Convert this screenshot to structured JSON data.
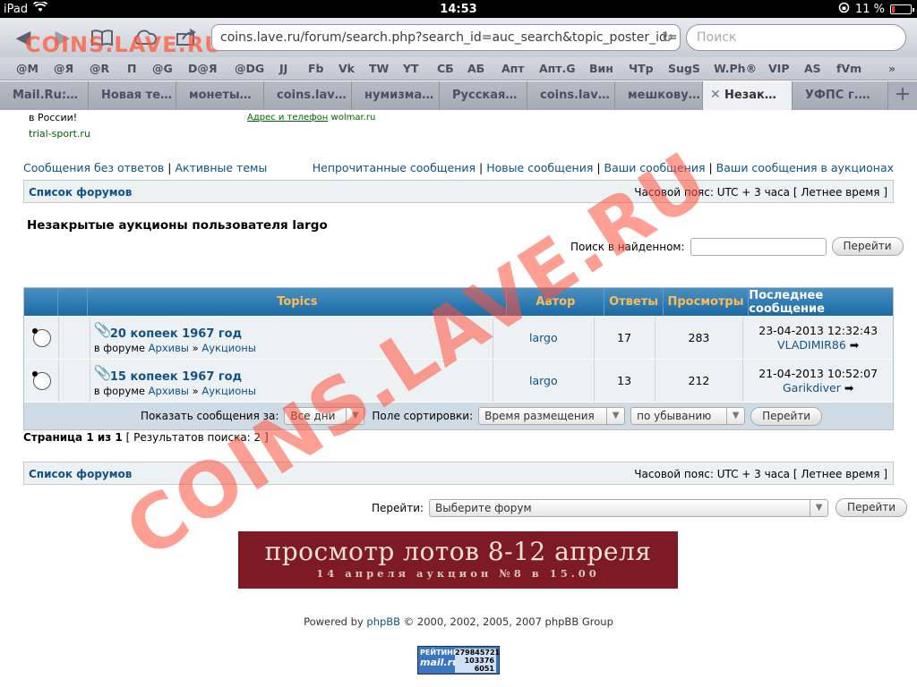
{
  "status_bar": {
    "device": "iPad",
    "time": "14:53",
    "battery": "11 %",
    "battery_level": 0.11
  },
  "browser": {
    "watermark_logo": "COINS.LAVE.RU",
    "url": "coins.lave.ru/forum/search.php?search_id=auc_search&topic_poster_id=",
    "search_placeholder": "Поиск",
    "bookmarks": [
      "@M",
      "@Я",
      "@R",
      "П",
      "@G",
      "D@Я",
      "@DG",
      "JJ",
      "Fb",
      "Vk",
      "TW",
      "YT",
      "СБ",
      "АБ",
      "Апт",
      "Апт.G",
      "Вин",
      "ЧТр",
      "SugS",
      "W.Ph®",
      "VIP",
      "AS",
      "fVm"
    ],
    "tabs": [
      "Mail.Ru:…",
      "Новая те…",
      "монеты…",
      "coins.lav…",
      "нумизма…",
      "Русская…",
      "coins.lav…",
      "мешкову…",
      "Незак…",
      "УФПС г.…"
    ],
    "active_tab_index": 8
  },
  "page": {
    "ad_left_1": "в России!",
    "ad_left_2": "trial-sport.ru",
    "ad_mid_link": "Адрес и телефон",
    "ad_mid_site": "wolmar.ru",
    "nav_left": [
      "Сообщения без ответов",
      "Активные темы"
    ],
    "nav_right": [
      "Непрочитанные сообщения",
      "Новые сообщения",
      "Ваши сообщения",
      "Ваши сообщения в аукционах"
    ],
    "forum_list": "Список форумов",
    "timezone": "Часовой пояс: UTC + 3 часа [ Летнее время ]",
    "heading": "Незакрытые аукционы пользователя largo",
    "search_found_label": "Поиск в найденном:",
    "go_button": "Перейти",
    "table": {
      "headers": [
        "Topics",
        "Автор",
        "Ответы",
        "Просмотры",
        "Последнее сообщение"
      ],
      "rows": [
        {
          "title": "20 копеек 1967 год",
          "in_forum": "в форуме",
          "forum1": "Архивы",
          "forum2": "Аукционы",
          "author": "largo",
          "replies": "17",
          "views": "283",
          "last_date": "23-04-2013 12:32:43",
          "last_user": "VLADIMIR86"
        },
        {
          "title": "15 копеек 1967 год",
          "in_forum": "в форуме",
          "forum1": "Архивы",
          "forum2": "Аукционы",
          "author": "largo",
          "replies": "13",
          "views": "212",
          "last_date": "21-04-2013 10:52:07",
          "last_user": "Garikdiver"
        }
      ]
    },
    "sortbar": {
      "show_label": "Показать сообщения за:",
      "show_value": "Все дни",
      "sort_label": "Поле сортировки:",
      "sort_value": "Время размещения",
      "order_value": "по убыванию",
      "go": "Перейти"
    },
    "pagination": "Страница 1 из 1",
    "results_count": "[ Результатов поиска: 2 ]",
    "jump_label": "Перейти:",
    "jump_value": "Выберите форум",
    "banner_line1": "просмотр лотов 8-12 апреля",
    "banner_line2": "14 апреля аукцион №8 в 15.00",
    "powered_prefix": "Powered by",
    "powered_link": "phpBB",
    "powered_suffix": "© 2000, 2002, 2005, 2007 phpBB Group",
    "counter_label": "РЕЙТИНГ",
    "counter_brand": "mail.ru",
    "counter_num1": "279845721",
    "counter_num2": "103376",
    "counter_num3": "6051",
    "watermark": "COINS.LAVE.RU"
  }
}
